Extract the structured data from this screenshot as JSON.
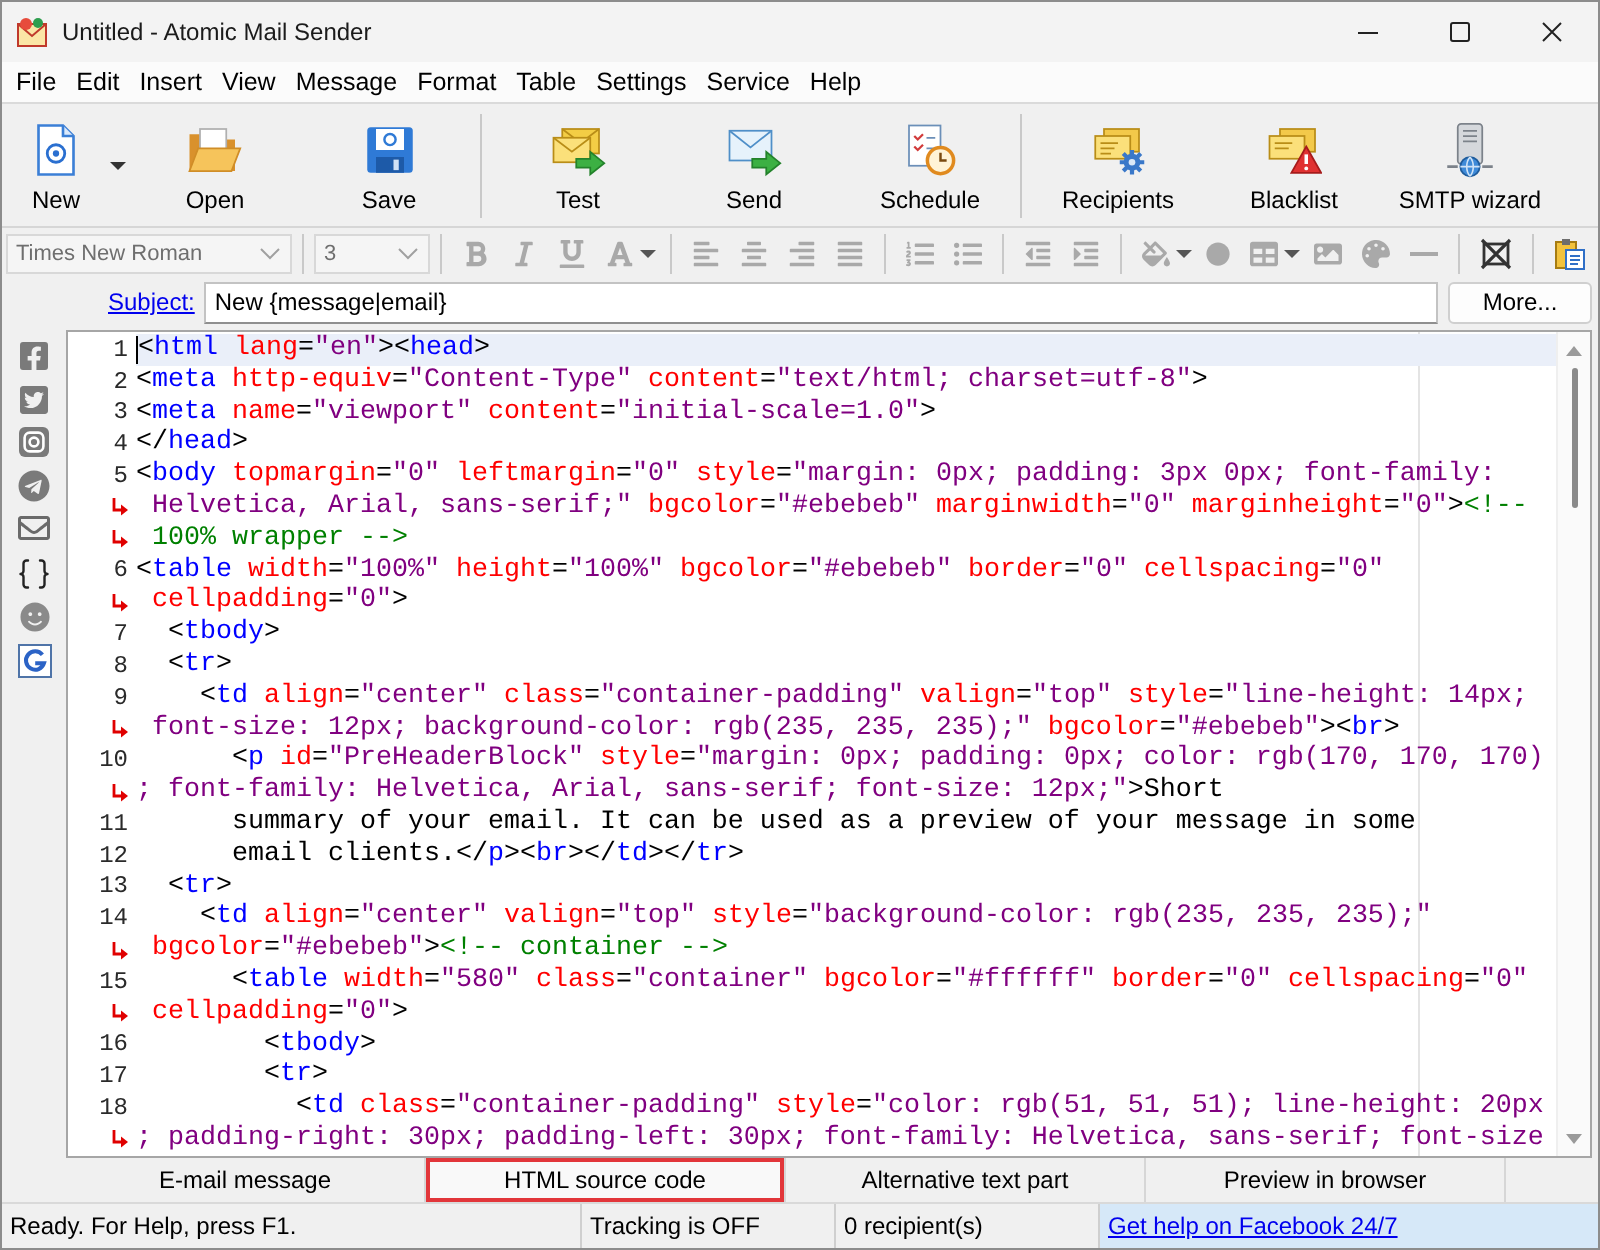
{
  "window": {
    "title": "Untitled - Atomic Mail Sender"
  },
  "menu": [
    "File",
    "Edit",
    "Insert",
    "View",
    "Message",
    "Format",
    "Table",
    "Settings",
    "Service",
    "Help"
  ],
  "toolbar": [
    [
      {
        "label": "New",
        "dropdown": true
      },
      {
        "label": "Open",
        "dropdown": false
      },
      {
        "label": "Save",
        "dropdown": false
      }
    ],
    [
      {
        "label": "Test",
        "dropdown": false
      },
      {
        "label": "Send",
        "dropdown": false
      },
      {
        "label": "Schedule",
        "dropdown": false
      }
    ],
    [
      {
        "label": "Recipients",
        "dropdown": false
      },
      {
        "label": "Blacklist",
        "dropdown": false
      },
      {
        "label": "SMTP wizard",
        "dropdown": false
      }
    ]
  ],
  "format_bar": {
    "disabled": true,
    "font": "Times New Roman",
    "size": "3"
  },
  "subject": {
    "label": "Subject:",
    "value": "New {message|email}",
    "more_button": "More..."
  },
  "editor": {
    "lines": [
      {
        "number": "1",
        "current": true,
        "rows": [
          "<html lang=\"en\"><head>"
        ]
      },
      {
        "number": "2",
        "current": false,
        "rows": [
          "<meta http-equiv=\"Content-Type\" content=\"text/html; charset=utf-8\">"
        ]
      },
      {
        "number": "3",
        "current": false,
        "rows": [
          "<meta name=\"viewport\" content=\"initial-scale=1.0\">"
        ]
      },
      {
        "number": "4",
        "current": false,
        "rows": [
          "</head>"
        ]
      },
      {
        "number": "5",
        "current": false,
        "rows": [
          "<body topmargin=\"0\" leftmargin=\"0\" style=\"margin: 0px; padding: 3px 0px; font-family:",
          " Helvetica, Arial, sans-serif;\" bgcolor=\"#ebebeb\" marginwidth=\"0\" marginheight=\"0\"><!--",
          " 100% wrapper -->"
        ]
      },
      {
        "number": "6",
        "current": false,
        "rows": [
          "<table width=\"100%\" height=\"100%\" bgcolor=\"#ebebeb\" border=\"0\" cellspacing=\"0\"",
          " cellpadding=\"0\">"
        ]
      },
      {
        "number": "7",
        "current": false,
        "rows": [
          "  <tbody>"
        ]
      },
      {
        "number": "8",
        "current": false,
        "rows": [
          "  <tr>"
        ]
      },
      {
        "number": "9",
        "current": false,
        "rows": [
          "    <td align=\"center\" class=\"container-padding\" valign=\"top\" style=\"line-height: 14px;",
          " font-size: 12px; background-color: rgb(235, 235, 235);\" bgcolor=\"#ebebeb\"><br>"
        ]
      },
      {
        "number": "10",
        "current": false,
        "rows": [
          "      <p id=\"PreHeaderBlock\" style=\"margin: 0px; padding: 0px; color: rgb(170, 170, 170)",
          "; font-family: Helvetica, Arial, sans-serif; font-size: 12px;\">Short"
        ]
      },
      {
        "number": "11",
        "current": false,
        "rows": [
          "      summary of your email. It can be used as a preview of your message in some"
        ]
      },
      {
        "number": "12",
        "current": false,
        "rows": [
          "      email clients.</p><br></td></tr>"
        ]
      },
      {
        "number": "13",
        "current": false,
        "rows": [
          "  <tr>"
        ]
      },
      {
        "number": "14",
        "current": false,
        "rows": [
          "    <td align=\"center\" valign=\"top\" style=\"background-color: rgb(235, 235, 235);\"",
          " bgcolor=\"#ebebeb\"><!-- container -->"
        ]
      },
      {
        "number": "15",
        "current": false,
        "rows": [
          "      <table width=\"580\" class=\"container\" bgcolor=\"#ffffff\" border=\"0\" cellspacing=\"0\"",
          " cellpadding=\"0\">"
        ]
      },
      {
        "number": "16",
        "current": false,
        "rows": [
          "        <tbody>"
        ]
      },
      {
        "number": "17",
        "current": false,
        "rows": [
          "        <tr>"
        ]
      },
      {
        "number": "18",
        "current": false,
        "rows": [
          "          <td class=\"container-padding\" style=\"color: rgb(51, 51, 51); line-height: 20px",
          "; padding-right: 30px; padding-left: 30px; font-family: Helvetica, sans-serif; font-size"
        ]
      }
    ]
  },
  "view_tabs": [
    {
      "label": "E-mail message",
      "selected": false
    },
    {
      "label": "HTML source code",
      "selected": true
    },
    {
      "label": "Alternative text part",
      "selected": false
    },
    {
      "label": "Preview in browser",
      "selected": false
    }
  ],
  "status_bar": {
    "message": "Ready. For Help, press F1.",
    "tracking": "Tracking is OFF",
    "recipients": "0 recipient(s)",
    "help_link": "Get help on Facebook 24/7"
  }
}
